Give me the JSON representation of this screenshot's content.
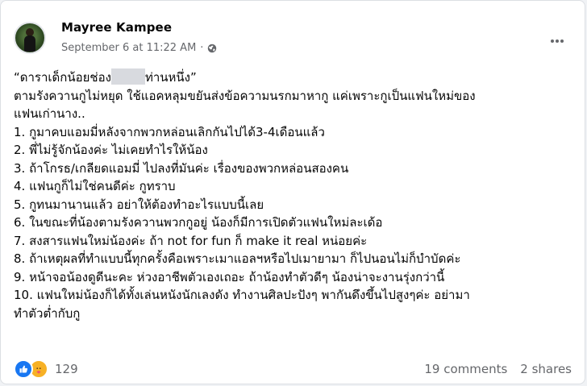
{
  "post": {
    "author": "Mayree Kampee",
    "timestamp": "September 6 at 11:22 AM",
    "separator": "·",
    "privacy_icon": "globe-icon",
    "more_icon": "more-options-icon"
  },
  "body": {
    "line0_a": "“ดาราเด็กน้อยช่อง",
    "line0_b": "ท่านหนึ่ง”",
    "lines": [
      "ตามรังควานกูไม่หยุด ใช้แอคหลุมขยันส่งข้อความนรกมาหากู แค่เพราะกูเป็นแฟนใหม่ของ",
      "แฟนเก่านาง..",
      "1. กูมาคบแอมมี่หลังจากพวกหล่อนเลิกกันไปได้3-4เดือนแล้ว",
      "2. พี่ไม่รู้จักน้องค่ะ ไม่เคยทำไรให้น้อง",
      "3. ถ้าโกรธ/เกลียดแอมมี่ ไปลงที่มันค่ะ เรื่องของพวกหล่อนสองคน",
      "4. แฟนกูก็ไม่ใช่คนดีค่ะ กูทราบ",
      "5. กูทนมานานแล้ว อย่าให้ต้องทำอะไรแบบนี้เลย",
      "6. ในขณะที่น้องตามรังควานพวกกูอยู่ น้องก็มีการเปิดตัวแฟนใหม่ละเด้อ",
      "7. สงสารแฟนใหม่น้องค่ะ ถ้า not for fun ก็ make it real หน่อยค่ะ",
      "8. ถ้าเหตุผลที่ทำแบบนี้ทุกครั้งคือเพราะเมาแอลฯหรือไปเมายามา ก็ไปนอนไม่ก็บำบัดค่ะ",
      "9. หน้าจอน้องดูดีนะคะ ห่วงอาชีพตัวเองเถอะ ถ้าน้องทำตัวดีๆ น้องน่าจะงานรุ่งกว่านี้",
      "10. แฟนใหม่น้องก็ได้ทั้งเล่นหนังนักเลงดัง ทำงานศิลปะปังๆ พากันดึงขึ้นไปสูงๆค่ะ อย่ามา",
      "ทำตัวต่ำกับกู"
    ]
  },
  "footer": {
    "reaction_icons": [
      "like-icon",
      "care-icon"
    ],
    "reaction_count": "129",
    "comments": "19 comments",
    "shares": "2 shares"
  },
  "colors": {
    "like_blue": "#1877f2",
    "care_yellow": "#f7b125",
    "secondary_text": "#65676b",
    "redaction": "#d8dadf"
  }
}
